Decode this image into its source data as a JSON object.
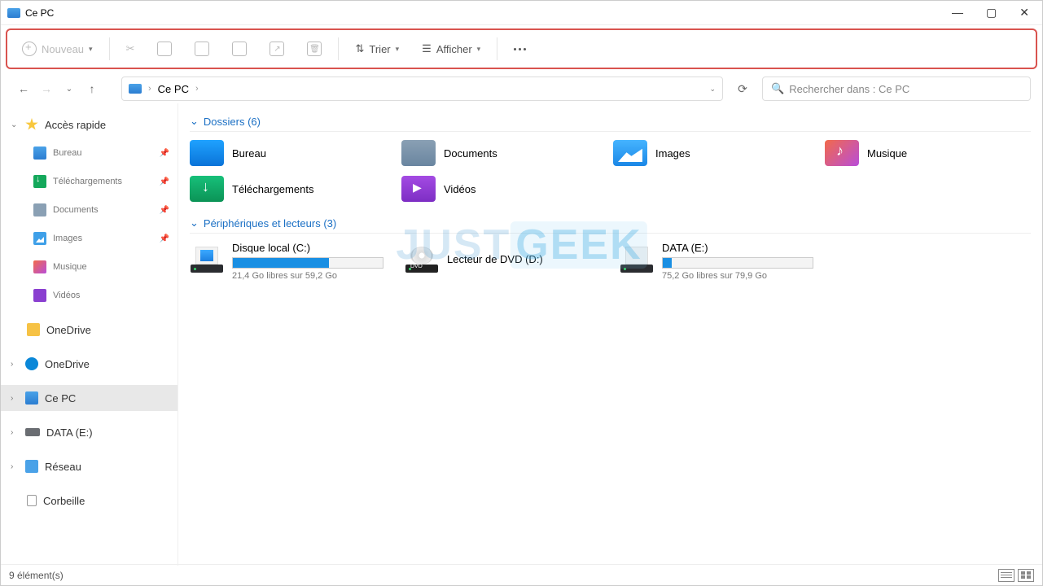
{
  "window": {
    "title": "Ce PC"
  },
  "toolbar": {
    "new_label": "Nouveau",
    "sort_label": "Trier",
    "view_label": "Afficher"
  },
  "breadcrumb": {
    "location": "Ce PC"
  },
  "search": {
    "placeholder": "Rechercher dans : Ce PC"
  },
  "sidebar": {
    "quick": "Accès rapide",
    "desktop": "Bureau",
    "downloads": "Téléchargements",
    "documents": "Documents",
    "images": "Images",
    "music": "Musique",
    "videos": "Vidéos",
    "onedrive_local": "OneDrive",
    "onedrive": "OneDrive",
    "thispc": "Ce PC",
    "data": "DATA (E:)",
    "network": "Réseau",
    "trash": "Corbeille"
  },
  "groups": {
    "folders": "Dossiers (6)",
    "drives": "Périphériques et lecteurs (3)"
  },
  "folders": {
    "desktop": "Bureau",
    "documents": "Documents",
    "images": "Images",
    "music": "Musique",
    "downloads": "Téléchargements",
    "videos": "Vidéos"
  },
  "drives": {
    "c": {
      "name": "Disque local (C:)",
      "used_pct": 64,
      "sub": "21,4 Go libres sur 59,2 Go"
    },
    "d": {
      "name": "Lecteur de DVD (D:)"
    },
    "e": {
      "name": "DATA (E:)",
      "used_pct": 6,
      "sub": "75,2 Go libres sur 79,9 Go"
    }
  },
  "status": {
    "count": "9 élément(s)"
  },
  "watermark": {
    "a": "JUST",
    "b": "GEEK"
  }
}
